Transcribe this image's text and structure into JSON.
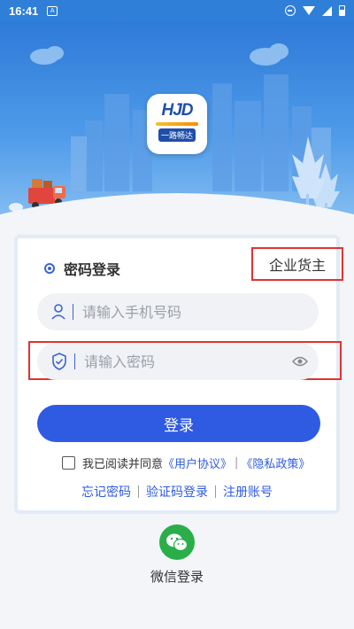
{
  "status_bar": {
    "time": "16:41",
    "notification_icon": "A"
  },
  "header": {
    "logo_brand": "HJD",
    "logo_tagline": "一路畅达"
  },
  "login_card": {
    "tab_label": "密码登录",
    "role_label": "企业货主",
    "phone_placeholder": "请输入手机号码",
    "password_placeholder": "请输入密码",
    "login_button": "登录",
    "agreement_prefix": "我已阅读并同意",
    "user_agreement": "《用户协议》",
    "agreement_separator": "|",
    "privacy_policy": "《隐私政策》",
    "forgot_password": "忘记密码",
    "code_login": "验证码登录",
    "register": "注册账号"
  },
  "wechat": {
    "label": "微信登录"
  },
  "colors": {
    "primary": "#2f5be3",
    "highlight": "#e03333",
    "wechat": "#2aae4a"
  }
}
